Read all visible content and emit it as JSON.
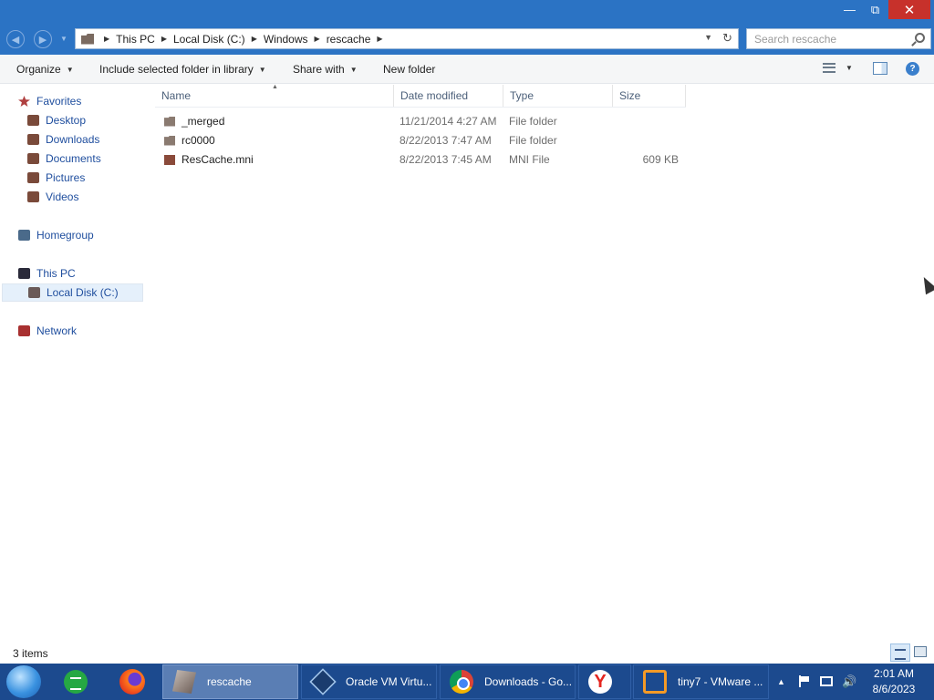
{
  "window": {
    "minimize_glyph": "—",
    "maximize_glyph": "⧉",
    "close_glyph": "✕"
  },
  "address": {
    "breadcrumbs": [
      "This PC",
      "Local Disk (C:)",
      "Windows",
      "rescache"
    ],
    "search_placeholder": "Search rescache"
  },
  "toolbar": {
    "organize": "Organize",
    "include_library": "Include selected folder in library",
    "share_with": "Share with",
    "new_folder": "New folder"
  },
  "navpane": {
    "favorites": "Favorites",
    "desktop": "Desktop",
    "downloads": "Downloads",
    "documents": "Documents",
    "pictures": "Pictures",
    "videos": "Videos",
    "homegroup": "Homegroup",
    "this_pc": "This PC",
    "local_disk": "Local Disk (C:)",
    "network": "Network"
  },
  "columns": {
    "name": "Name",
    "date_modified": "Date modified",
    "type": "Type",
    "size": "Size"
  },
  "files": [
    {
      "name": "_merged",
      "date": "11/21/2014 4:27 AM",
      "type": "File folder",
      "size": "",
      "icon": "folder-icon"
    },
    {
      "name": "rc0000",
      "date": "8/22/2013 7:47 AM",
      "type": "File folder",
      "size": "",
      "icon": "folder-icon"
    },
    {
      "name": "ResCache.mni",
      "date": "8/22/2013 7:45 AM",
      "type": "MNI File",
      "size": "609 KB",
      "icon": "file-icon"
    }
  ],
  "status": {
    "item_count": "3 items"
  },
  "taskbar": {
    "tasks": [
      {
        "label": "rescache",
        "icon": "file-explorer-icon",
        "active": true
      },
      {
        "label": "Oracle VM Virtu...",
        "icon": "virtualbox-icon",
        "active": false
      },
      {
        "label": "Downloads - Go...",
        "icon": "chrome-icon",
        "active": false
      },
      {
        "label": "",
        "icon": "yandex-icon",
        "active": false
      },
      {
        "label": "tiny7 - VMware ...",
        "icon": "vmware-icon",
        "active": false
      }
    ],
    "yandex_glyph": "Y",
    "clock_time": "2:01 AM",
    "clock_date": "8/6/2023"
  },
  "colors": {
    "titlebar": "#2b73c4",
    "close_button": "#c7312b",
    "taskbar": "#1c4a8e",
    "link_text": "#1f4e9e"
  }
}
